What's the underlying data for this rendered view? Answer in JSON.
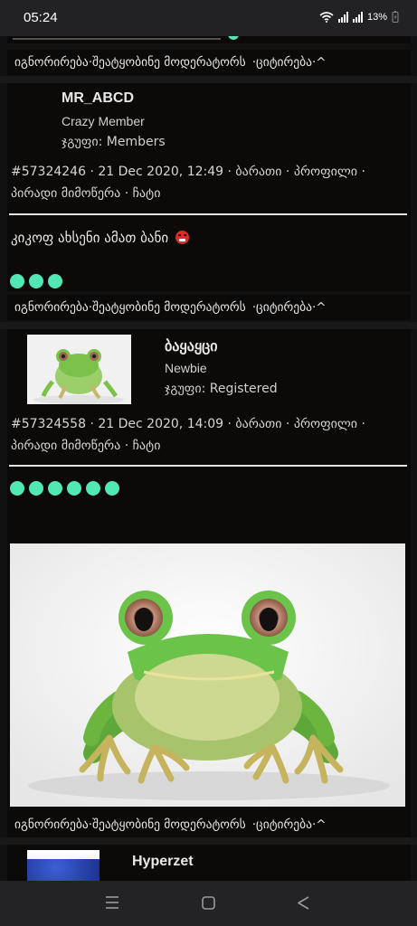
{
  "status_bar": {
    "time": "05:24",
    "battery": "13%"
  },
  "top_actions": {
    "ignore": "იგნორირება",
    "sep": " · ",
    "report": "შეატყობინე მოდერატორს",
    "quote": "ციტირება",
    "up": "^"
  },
  "post1": {
    "username": "MR_ABCD",
    "rank": "Crazy Member",
    "group": "ჯგუფი: Members",
    "id": "#57324246",
    "date": "21 Dec 2020, 12:49",
    "link_pm": "ბარათი",
    "link_profile": "პროფილი",
    "link_private": "პირადი მიმოწერა",
    "link_chat": "ჩატი",
    "message": "კიკოფ ახსენი ამათ ბანი",
    "message_emoji": "😡",
    "rating_dots": 3
  },
  "post2": {
    "username": "ბაყაყცი",
    "rank": "Newbie",
    "group": "ჯგუფი: Registered",
    "id": "#57324558",
    "date": "21 Dec 2020, 14:09",
    "link_pm": "ბარათი",
    "link_profile": "პროფილი",
    "link_private": "პირადი მიმოწერა",
    "link_chat": "ჩატი",
    "rating_dots": 6
  },
  "post3": {
    "username": "Hyperzet"
  },
  "colors": {
    "accent": "#52e8b6",
    "background": "#0b0a09",
    "page": "#121111",
    "frog_green": "#6cc34a"
  },
  "icons": {
    "wifi": "wifi-icon",
    "signal": "signal-icon",
    "battery": "battery-icon",
    "nav_recent": "recent-apps-icon",
    "nav_home": "home-icon",
    "nav_back": "back-icon"
  }
}
